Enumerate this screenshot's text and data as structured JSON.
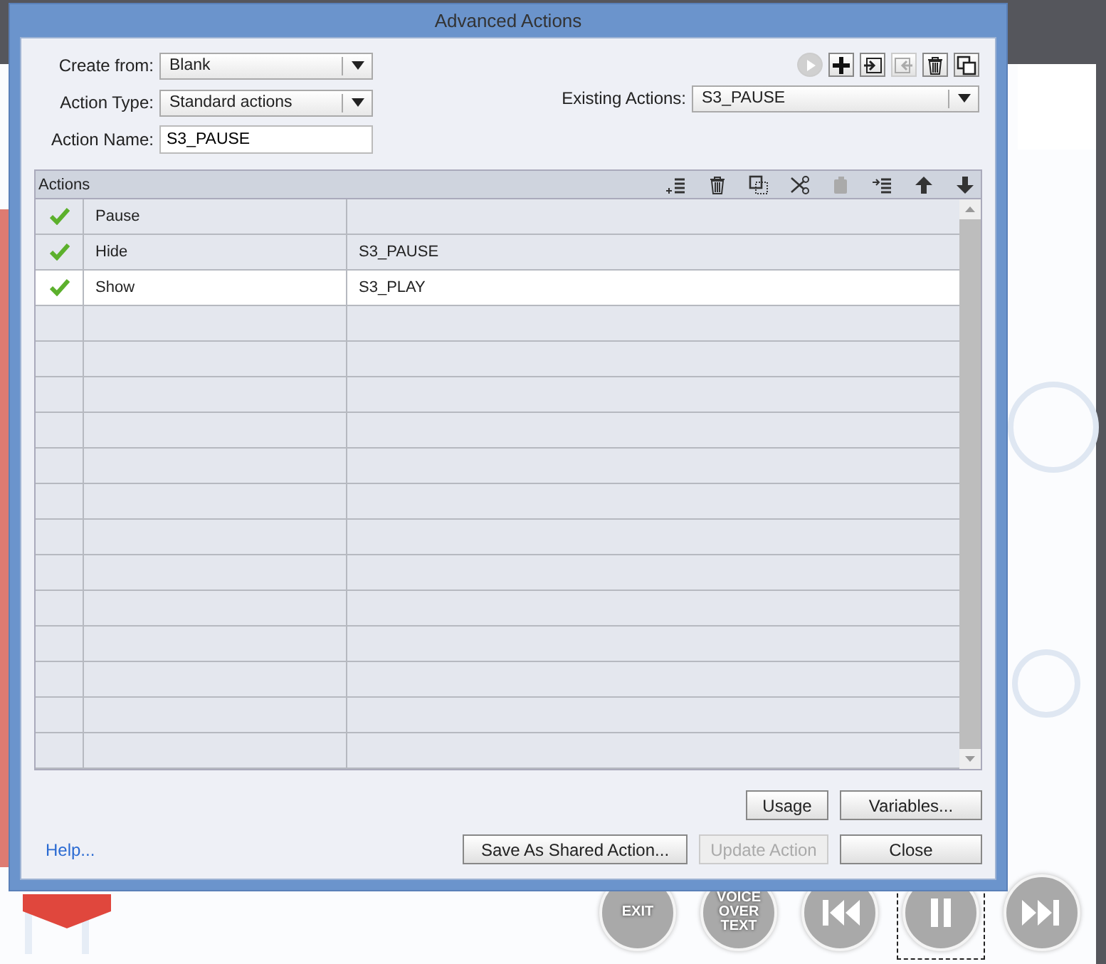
{
  "window": {
    "title": "Advanced Actions"
  },
  "form": {
    "create_from": {
      "label": "Create from:",
      "value": "Blank"
    },
    "action_type": {
      "label": "Action Type:",
      "value": "Standard actions"
    },
    "action_name": {
      "label": "Action Name:",
      "value": "S3_PAUSE"
    },
    "existing_actions": {
      "label": "Existing Actions:",
      "value": "S3_PAUSE"
    }
  },
  "top_toolbar": [
    {
      "kind": "play",
      "disabled": true
    },
    {
      "kind": "add",
      "disabled": false
    },
    {
      "kind": "import",
      "disabled": false
    },
    {
      "kind": "export",
      "disabled": true
    },
    {
      "kind": "delete",
      "disabled": false
    },
    {
      "kind": "duplicate",
      "disabled": false
    }
  ],
  "table": {
    "title": "Actions",
    "toolbar": [
      {
        "kind": "add-row",
        "disabled": false
      },
      {
        "kind": "delete",
        "disabled": false
      },
      {
        "kind": "copy",
        "disabled": false
      },
      {
        "kind": "cut",
        "disabled": false
      },
      {
        "kind": "paste",
        "disabled": true
      },
      {
        "kind": "insert",
        "disabled": false
      },
      {
        "kind": "up",
        "disabled": false
      },
      {
        "kind": "down",
        "disabled": false
      }
    ],
    "rows": [
      {
        "checked": true,
        "action": "Pause",
        "selected": false
      },
      {
        "checked": true,
        "action": "Hide",
        "target": "S3_PAUSE",
        "selected": false
      },
      {
        "checked": true,
        "action": "Show",
        "target": "S3_PLAY",
        "selected": true
      }
    ]
  },
  "buttons_top": [
    {
      "label": "Usage",
      "disabled": false
    },
    {
      "label": "Variables...",
      "disabled": false
    }
  ],
  "help_link": "Help...",
  "buttons_bottom": [
    {
      "label": "Save As Shared Action...",
      "disabled": false
    },
    {
      "label": "Update Action",
      "disabled": true
    },
    {
      "label": "Close",
      "disabled": false
    }
  ],
  "slide_buttons": [
    {
      "kind": "text",
      "label": "EXIT"
    },
    {
      "kind": "text",
      "label": "VOICE OVER TEXT"
    },
    {
      "kind": "rewind"
    },
    {
      "kind": "pause",
      "selected": true
    },
    {
      "kind": "forward"
    }
  ]
}
